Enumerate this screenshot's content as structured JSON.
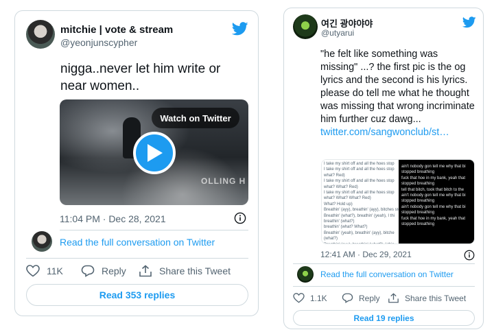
{
  "colors": {
    "accent": "#1d9bf0",
    "text": "#0f1419",
    "muted": "#536471",
    "border": "#cfd9de"
  },
  "tweet1": {
    "display_name": "mitchie | vote & stream",
    "handle": "@yeonjunscypher",
    "text": "nigga..never let him write or near women..",
    "video": {
      "watch_label": "Watch on Twitter",
      "overlay_text": "OLLING H"
    },
    "timestamp": "11:04 PM · Dec 28, 2021",
    "conversation_link": "Read the full conversation on Twitter",
    "like_count": "11K",
    "reply_label": "Reply",
    "share_label": "Share this Tweet",
    "read_replies": "Read 353 replies"
  },
  "tweet2": {
    "display_name": "여긴 광야야야",
    "handle": "@utyarui",
    "text": "\"he felt like something was missing\" ...? the first pic is the og lyrics and the second is his lyrics. please do tell me what he thought was missing that wrong incriminate him further cuz dawg...",
    "link": "twitter.com/sangwonclub/st…",
    "media_left_lines": [
      "I take my shirt off and all the hoes stop",
      "I take my shirt off and all the hoes stop",
      "what? Red)",
      "I take my shirt off and all the hoes stop",
      "what? What? Red)",
      "I take my shirt off and all the hoes stop",
      "what? What? What? Red)",
      "What? Hold up)",
      "Breathin' (ayy), breathin' (ayy), bitches stop",
      "Breathin' (what?), breathin' (yeah), I thi",
      "breathin' (what?)",
      "breathin' (what? What?)",
      "Breathin' (yeah), breathin' (ayy), bitche",
      "(what?)",
      "Breathin' (ayy), breathin' (what?), I thin",
      "breathin' (what?)"
    ],
    "media_right_lines": [
      "ain't nobody gon tell me why that bi",
      "stopped breathing",
      "fuck that hoe in my bank, yeah that",
      "stopped breathing",
      "tell that bitch, took that bitch to the",
      "ain't nobody gon tell me why that bi",
      "stopped breathing",
      "ain't nobody gon tell me why that bi",
      "stopped breathing",
      "fuck that hoe in my bank, yeah that",
      "stopped breathing"
    ],
    "timestamp": "12:41 AM · Dec 29, 2021",
    "conversation_link": "Read the full conversation on Twitter",
    "like_count": "1.1K",
    "reply_label": "Reply",
    "share_label": "Share this Tweet",
    "read_replies": "Read 19 replies"
  }
}
